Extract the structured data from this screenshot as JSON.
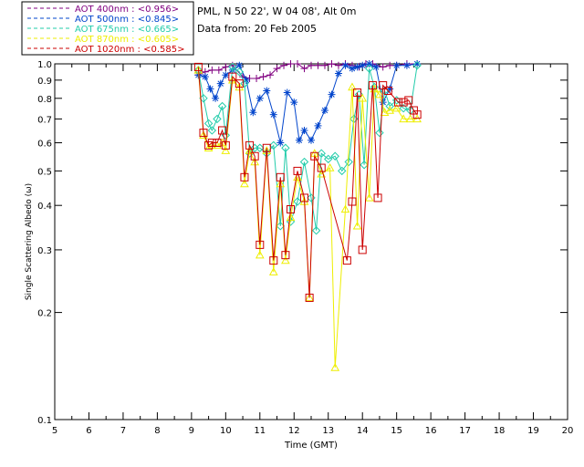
{
  "header": {
    "site_line": "PML, N 50 22', W 04 08', Alt 0m",
    "date_line": "Data from: 20 Feb 2005"
  },
  "chart_data": {
    "type": "line",
    "xlabel": "Time (GMT)",
    "ylabel": "Single Scattering Albedo (ω)",
    "xlim": [
      5,
      20
    ],
    "ylim": [
      0.1,
      1.0
    ],
    "yscale": "log",
    "grid": false,
    "legend_position": "top-left-outside",
    "xticks": [
      "5",
      "6",
      "7",
      "8",
      "9",
      "10",
      "11",
      "12",
      "13",
      "14",
      "15",
      "16",
      "17",
      "18",
      "19",
      "20"
    ],
    "yticks": [
      {
        "value": 0.1,
        "label": "0.1"
      },
      {
        "value": 0.2,
        "label": "0.2"
      },
      {
        "value": 0.3,
        "label": "0.3"
      },
      {
        "value": 0.4,
        "label": "0.4"
      },
      {
        "value": 0.5,
        "label": "0.5"
      },
      {
        "value": 0.6,
        "label": "0.6"
      },
      {
        "value": 0.7,
        "label": "0.7"
      },
      {
        "value": 0.8,
        "label": "0.8"
      },
      {
        "value": 0.9,
        "label": "0.9"
      },
      {
        "value": 1.0,
        "label": "1.0"
      }
    ],
    "series": [
      {
        "name": "AOT  400nm : <0.956>",
        "color": "#800080",
        "marker": "plus",
        "x": [
          9.2,
          9.4,
          9.6,
          9.8,
          10.0,
          10.2,
          10.5,
          10.7,
          10.9,
          11.1,
          11.3,
          11.5,
          11.7,
          11.9,
          12.1,
          12.3,
          12.5,
          12.7,
          12.9,
          13.1,
          13.3,
          13.5,
          13.7,
          13.9,
          14.1,
          14.3,
          14.6,
          14.8,
          15.0,
          15.3,
          15.6
        ],
        "y": [
          0.93,
          0.95,
          0.96,
          0.96,
          0.98,
          0.99,
          0.92,
          0.91,
          0.91,
          0.92,
          0.93,
          0.97,
          0.99,
          1.0,
          1.0,
          0.97,
          0.99,
          0.99,
          0.99,
          1.0,
          0.99,
          1.0,
          0.99,
          0.98,
          1.0,
          1.0,
          0.98,
          0.99,
          0.99,
          1.0,
          1.0
        ]
      },
      {
        "name": "AOT  500nm : <0.845>",
        "color": "#0044cc",
        "marker": "asterisk",
        "x": [
          9.2,
          9.4,
          9.55,
          9.7,
          9.85,
          10.0,
          10.2,
          10.4,
          10.6,
          10.8,
          11.0,
          11.2,
          11.4,
          11.6,
          11.8,
          12.0,
          12.15,
          12.3,
          12.5,
          12.7,
          12.9,
          13.1,
          13.3,
          13.5,
          13.7,
          13.85,
          14.0,
          14.2,
          14.4,
          14.6,
          14.8,
          15.0,
          15.3,
          15.6
        ],
        "y": [
          0.93,
          0.92,
          0.85,
          0.8,
          0.88,
          0.93,
          0.96,
          0.99,
          0.9,
          0.73,
          0.8,
          0.84,
          0.72,
          0.6,
          0.83,
          0.78,
          0.61,
          0.65,
          0.61,
          0.67,
          0.74,
          0.82,
          0.94,
          0.99,
          0.97,
          0.98,
          0.99,
          1.0,
          0.98,
          0.78,
          0.85,
          0.99,
          0.99,
          1.0
        ]
      },
      {
        "name": "AOT  675nm : <0.665>",
        "color": "#22ccaa",
        "marker": "diamond",
        "x": [
          9.2,
          9.35,
          9.5,
          9.6,
          9.75,
          9.9,
          10.0,
          10.2,
          10.4,
          10.55,
          10.7,
          10.85,
          11.0,
          11.2,
          11.4,
          11.6,
          11.75,
          11.9,
          12.1,
          12.3,
          12.5,
          12.65,
          12.8,
          13.0,
          13.2,
          13.4,
          13.6,
          13.75,
          13.9,
          14.05,
          14.2,
          14.35,
          14.5,
          14.65,
          14.8,
          15.0,
          15.2,
          15.4,
          15.6
        ],
        "y": [
          0.96,
          0.8,
          0.68,
          0.65,
          0.7,
          0.76,
          0.63,
          0.98,
          0.95,
          0.88,
          0.56,
          0.58,
          0.58,
          0.56,
          0.59,
          0.35,
          0.58,
          0.36,
          0.41,
          0.53,
          0.42,
          0.34,
          0.56,
          0.54,
          0.55,
          0.5,
          0.53,
          0.7,
          0.82,
          0.52,
          0.97,
          0.86,
          0.64,
          0.84,
          0.76,
          0.79,
          0.75,
          0.74,
          0.99
        ]
      },
      {
        "name": "AOT  870nm : <0.605>",
        "color": "#eeee00",
        "marker": "triangle",
        "x": [
          9.2,
          9.35,
          9.5,
          9.6,
          9.75,
          9.9,
          10.0,
          10.2,
          10.4,
          10.55,
          10.7,
          10.85,
          11.0,
          11.2,
          11.4,
          11.6,
          11.75,
          11.9,
          12.1,
          12.3,
          12.45,
          12.6,
          12.8,
          13.05,
          13.2,
          13.5,
          13.7,
          13.85,
          14.0,
          14.2,
          14.35,
          14.5,
          14.65,
          14.8,
          15.0,
          15.2,
          15.4,
          15.6
        ],
        "y": [
          0.96,
          0.63,
          0.58,
          0.59,
          0.59,
          0.6,
          0.57,
          0.9,
          0.86,
          0.46,
          0.57,
          0.53,
          0.29,
          0.57,
          0.26,
          0.46,
          0.28,
          0.37,
          0.48,
          0.41,
          0.22,
          0.56,
          0.49,
          0.51,
          0.14,
          0.39,
          0.86,
          0.35,
          0.8,
          0.42,
          0.85,
          0.82,
          0.73,
          0.74,
          0.75,
          0.7,
          0.7,
          0.7
        ]
      },
      {
        "name": "AOT 1020nm : <0.585>",
        "color": "#cc0000",
        "marker": "square",
        "x": [
          9.2,
          9.35,
          9.5,
          9.6,
          9.75,
          9.9,
          10.0,
          10.2,
          10.4,
          10.55,
          10.7,
          10.85,
          11.0,
          11.2,
          11.4,
          11.6,
          11.75,
          11.9,
          12.1,
          12.3,
          12.45,
          12.6,
          12.8,
          13.55,
          13.7,
          13.85,
          14.0,
          14.3,
          14.45,
          14.6,
          14.75,
          15.05,
          15.2,
          15.35,
          15.5,
          15.6
        ],
        "y": [
          0.98,
          0.64,
          0.59,
          0.6,
          0.6,
          0.65,
          0.59,
          0.92,
          0.88,
          0.48,
          0.59,
          0.55,
          0.31,
          0.58,
          0.28,
          0.48,
          0.29,
          0.39,
          0.5,
          0.42,
          0.22,
          0.55,
          0.51,
          0.28,
          0.41,
          0.83,
          0.3,
          0.87,
          0.42,
          0.87,
          0.84,
          0.78,
          0.78,
          0.79,
          0.74,
          0.72
        ]
      }
    ]
  }
}
